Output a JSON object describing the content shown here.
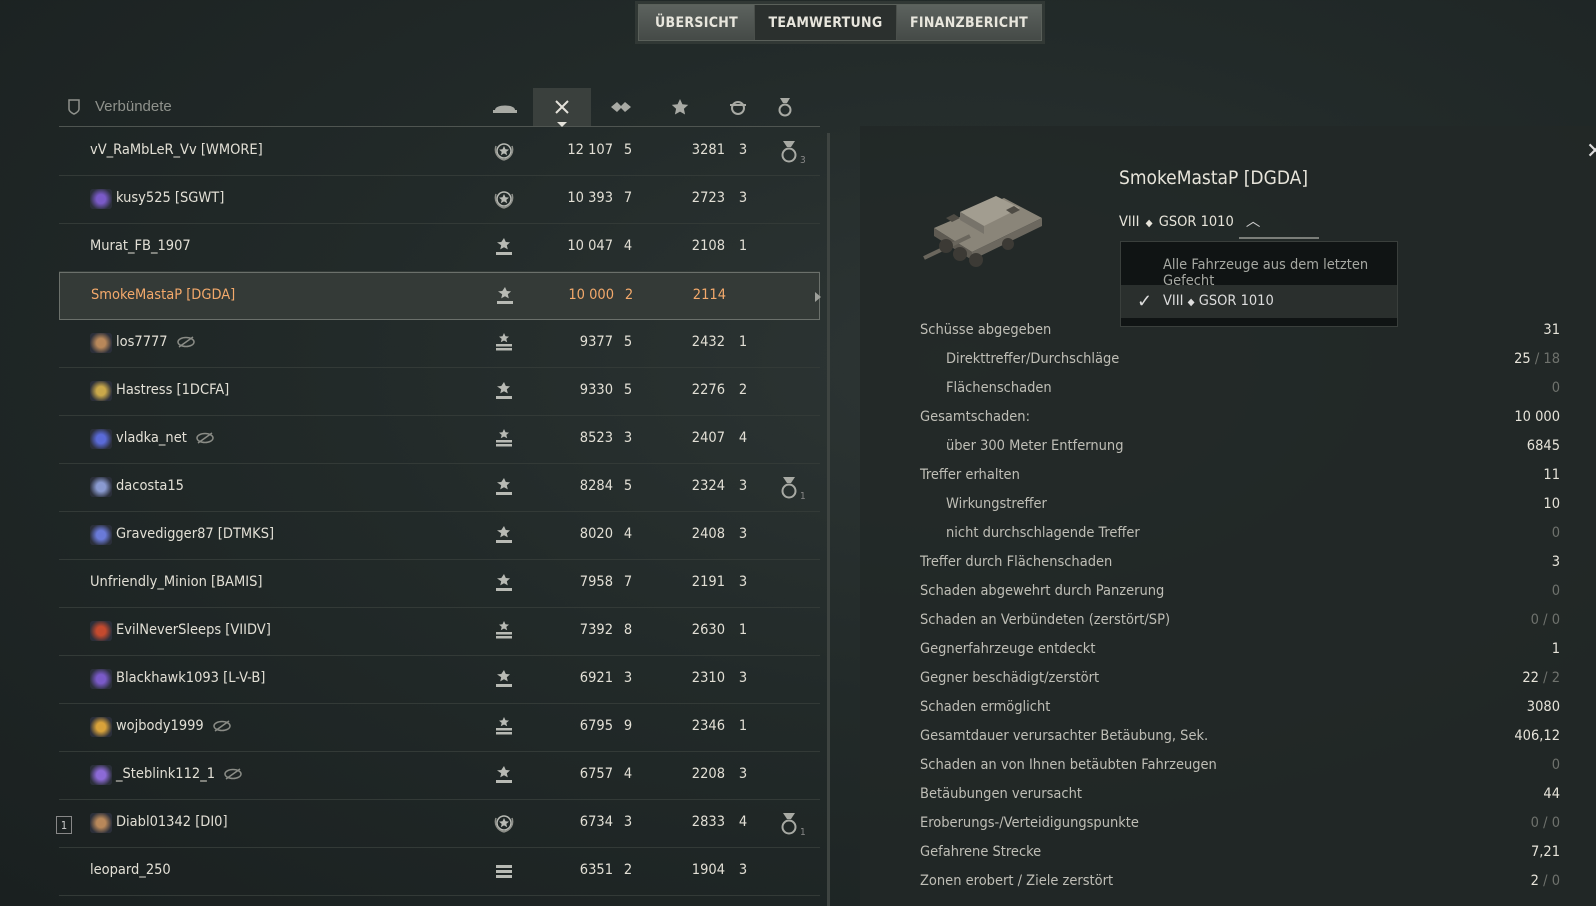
{
  "tabs": [
    "ÜBERSICHT",
    "TEAMWERTUNG",
    "FINANZBERICHT"
  ],
  "team_header": {
    "title": "Verbündete"
  },
  "columns": [
    "rank-icon",
    "damage-icon",
    "kills-icon",
    "xp-icon",
    "spotted-icon",
    "medal-icon"
  ],
  "players": [
    {
      "name": "vV_RaMbLeR_Vv [WMORE]",
      "clan_icon": false,
      "damage": "12 107",
      "kills": "5",
      "xp": "3281",
      "frags": "3",
      "medal": "3",
      "rank": "wreath",
      "eye": false
    },
    {
      "name": "kusy525 [SGWT]",
      "clan_icon": true,
      "damage": "10 393",
      "kills": "7",
      "xp": "2723",
      "frags": "3",
      "medal": "",
      "rank": "wreath",
      "eye": false
    },
    {
      "name": "Murat_FB_1907",
      "clan_icon": false,
      "damage": "10 047",
      "kills": "4",
      "xp": "2108",
      "frags": "1",
      "medal": "",
      "rank": "star",
      "eye": false
    },
    {
      "name": "SmokeMastaP [DGDA]",
      "clan_icon": false,
      "damage": "10 000",
      "kills": "2",
      "xp": "2114",
      "frags": "",
      "medal": "",
      "rank": "star",
      "eye": false,
      "selected": true
    },
    {
      "name": "los7777",
      "clan_icon": true,
      "damage": "9377",
      "kills": "5",
      "xp": "2432",
      "frags": "1",
      "medal": "",
      "rank": "star3",
      "eye": true
    },
    {
      "name": "Hastress [1DCFA]",
      "clan_icon": true,
      "damage": "9330",
      "kills": "5",
      "xp": "2276",
      "frags": "2",
      "medal": "",
      "rank": "star",
      "eye": false
    },
    {
      "name": "vladka_net",
      "clan_icon": true,
      "damage": "8523",
      "kills": "3",
      "xp": "2407",
      "frags": "4",
      "medal": "",
      "rank": "star3",
      "eye": true
    },
    {
      "name": "dacosta15",
      "clan_icon": true,
      "damage": "8284",
      "kills": "5",
      "xp": "2324",
      "frags": "3",
      "medal": "1",
      "rank": "star",
      "eye": false
    },
    {
      "name": "Gravedigger87 [DTMKS]",
      "clan_icon": true,
      "damage": "8020",
      "kills": "4",
      "xp": "2408",
      "frags": "3",
      "medal": "",
      "rank": "star",
      "eye": false
    },
    {
      "name": "Unfriendly_Minion [BAMIS]",
      "clan_icon": false,
      "damage": "7958",
      "kills": "7",
      "xp": "2191",
      "frags": "3",
      "medal": "",
      "rank": "star",
      "eye": false
    },
    {
      "name": "EvilNeverSleeps [VIIDV]",
      "clan_icon": true,
      "damage": "7392",
      "kills": "8",
      "xp": "2630",
      "frags": "1",
      "medal": "",
      "rank": "star3",
      "eye": false
    },
    {
      "name": "Blackhawk1093 [L-V-B]",
      "clan_icon": true,
      "damage": "6921",
      "kills": "3",
      "xp": "2310",
      "frags": "3",
      "medal": "",
      "rank": "star",
      "eye": false
    },
    {
      "name": "wojbody1999",
      "clan_icon": true,
      "damage": "6795",
      "kills": "9",
      "xp": "2346",
      "frags": "1",
      "medal": "",
      "rank": "star3",
      "eye": true
    },
    {
      "name": "_Steblink112_1",
      "clan_icon": true,
      "damage": "6757",
      "kills": "4",
      "xp": "2208",
      "frags": "3",
      "medal": "",
      "rank": "star",
      "eye": true
    },
    {
      "name": "Diabl01342 [DI0]",
      "clan_icon": true,
      "damage": "6734",
      "kills": "3",
      "xp": "2833",
      "frags": "4",
      "medal": "1",
      "rank": "wreath",
      "eye": false,
      "platoon": "1"
    },
    {
      "name": "leopard_250",
      "clan_icon": false,
      "damage": "6351",
      "kills": "2",
      "xp": "1904",
      "frags": "3",
      "medal": "",
      "rank": "bars",
      "eye": false
    }
  ],
  "detail": {
    "player": "SmokeMastaP [DGDA]",
    "vehicle_tier": "VIII",
    "vehicle_name": "GSOR 1010",
    "dropdown": {
      "all": "Alle Fahrzeuge aus dem letzten Gefecht",
      "selected_tier": "VIII",
      "selected_name": "GSOR 1010"
    },
    "stats": [
      {
        "label": "Schüsse abgegeben",
        "value": "31",
        "sub": false
      },
      {
        "label": "Direkttreffer/Durchschläge",
        "value": "25",
        "value2": "18",
        "sub": true
      },
      {
        "label": "Flächenschaden",
        "value": "0",
        "sub": true,
        "dim": true
      },
      {
        "label": "Gesamtschaden:",
        "value": "10 000",
        "sub": false
      },
      {
        "label": "über 300 Meter Entfernung",
        "value": "6845",
        "sub": true
      },
      {
        "label": "Treffer erhalten",
        "value": "11",
        "sub": false
      },
      {
        "label": "Wirkungstreffer",
        "value": "10",
        "sub": true
      },
      {
        "label": "nicht durchschlagende Treffer",
        "value": "0",
        "sub": true,
        "dim": true
      },
      {
        "label": "Treffer durch Flächenschaden",
        "value": "3",
        "sub": false
      },
      {
        "label": "Schaden abgewehrt durch Panzerung",
        "value": "0",
        "sub": false,
        "dim": true
      },
      {
        "label": "Schaden an Verbündeten (zerstört/SP)",
        "value": "0",
        "value2": "0",
        "sub": false,
        "dim": true
      },
      {
        "label": "Gegnerfahrzeuge entdeckt",
        "value": "1",
        "sub": false
      },
      {
        "label": "Gegner beschädigt/zerstört",
        "value": "22",
        "value2": "2",
        "sub": false
      },
      {
        "label": "Schaden ermöglicht",
        "value": "3080",
        "sub": false
      },
      {
        "label": "Gesamtdauer verursachter Betäubung, Sek.",
        "value": "406,12",
        "sub": false
      },
      {
        "label": "Schaden an von Ihnen betäubten Fahrzeugen",
        "value": "0",
        "sub": false,
        "dim": true
      },
      {
        "label": "Betäubungen verursacht",
        "value": "44",
        "sub": false
      },
      {
        "label": "Eroberungs-/Verteidigungspunkte",
        "value": "0",
        "value2": "0",
        "sub": false,
        "dim": true
      },
      {
        "label": "Gefahrene Strecke",
        "value": "7,21",
        "sub": false
      },
      {
        "label": "Zonen erobert / Ziele zerstört",
        "value": "2",
        "value2": "0",
        "sub": false
      }
    ]
  }
}
